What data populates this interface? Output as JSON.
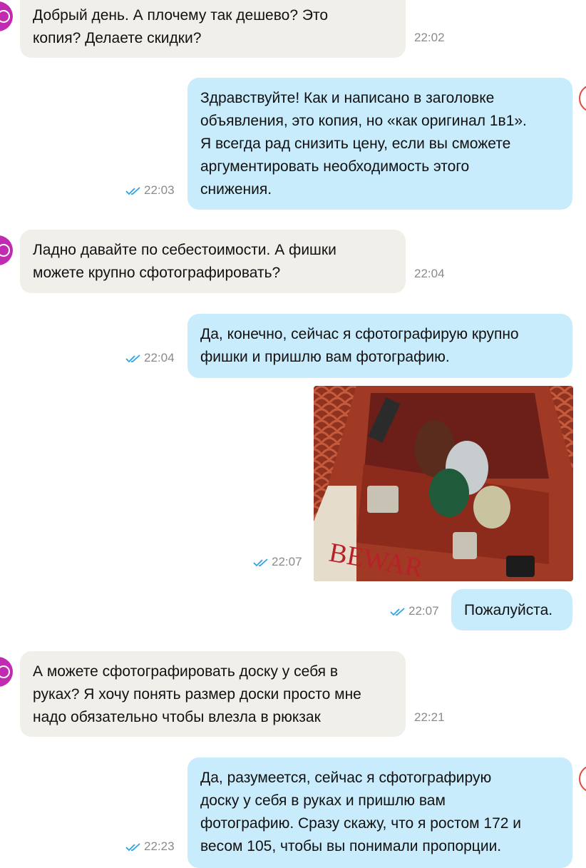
{
  "messages": [
    {
      "text": "Добрый день. А плочему так дешево? Это\nкопия? Делаете скидки?",
      "time": "22:02"
    },
    {
      "text": "Здравствуйте! Как и написано в заголовке\nобъявления, это копия, но «как оригинал 1в1».\nЯ всегда рад снизить цену, если вы сможете\nаргументировать необходимость этого\nснижения.",
      "time": "22:03"
    },
    {
      "text": "Ладно давайте по себестоимости. А фишки\nможете крупно сфотографировать?",
      "time": "22:04"
    },
    {
      "text": "Да, конечно, сейчас я сфотографирую крупно\nфишки и пришлю вам фотографию.",
      "time": "22:04"
    },
    {
      "photo_caption": "BEWAR",
      "time": "22:07"
    },
    {
      "text": "Пожалуйста.",
      "time": "22:07"
    },
    {
      "text": "А можете сфотографировать доску у себя в\nруках? Я хочу понять размер доски просто мне\nнадо обязательно чтобы влезла в рюкзак",
      "time": "22:21"
    },
    {
      "text": "Да, разумеется, сейчас я сфотографирую\nдоску у себя в руках и пришлю вам\nфотографию. Сразу скажу, что я ростом 172 и\nвесом 105, чтобы вы понимали пропорции.",
      "time": "22:23"
    }
  ],
  "colors": {
    "incoming_bubble": "#f1efea",
    "outgoing_bubble": "#c8ecfc",
    "read_ticks": "#2aa4e6",
    "avatar": "#c02bb2"
  }
}
